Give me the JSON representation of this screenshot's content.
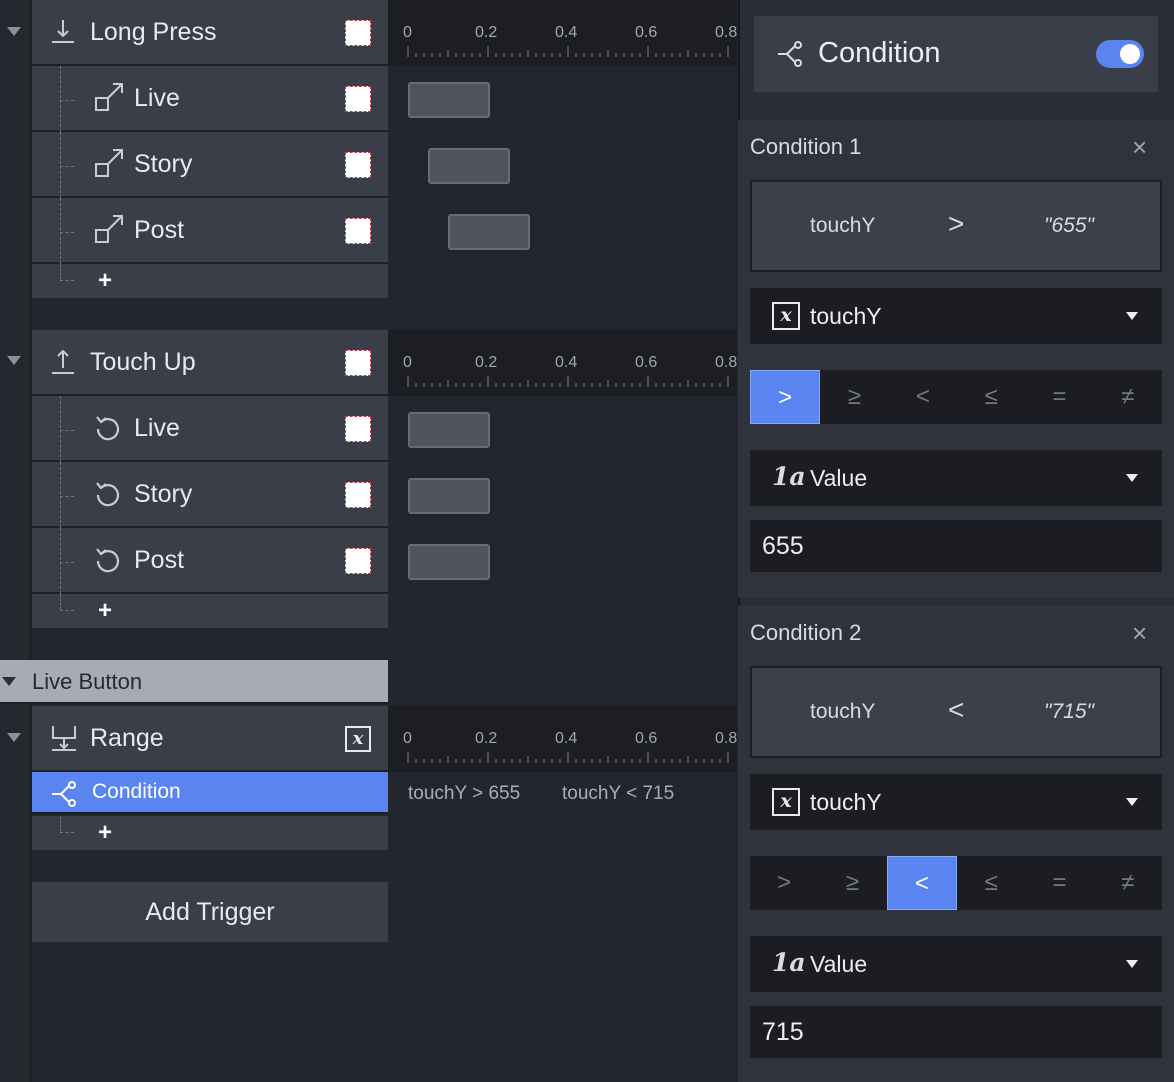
{
  "triggers": {
    "long_press": {
      "label": "Long Press",
      "children": [
        {
          "label": "Live"
        },
        {
          "label": "Story"
        },
        {
          "label": "Post"
        }
      ]
    },
    "touch_up": {
      "label": "Touch Up",
      "children": [
        {
          "label": "Live"
        },
        {
          "label": "Story"
        },
        {
          "label": "Post"
        }
      ]
    },
    "range": {
      "label": "Range",
      "children": [
        {
          "label": "Condition"
        }
      ]
    }
  },
  "add_symbol": "+",
  "group": {
    "label": "Live Button"
  },
  "add_trigger_label": "Add Trigger",
  "timeline": {
    "ticks": [
      "0",
      "0.2",
      "0.4",
      "0.6",
      "0.8"
    ],
    "range_conditions": [
      "touchY > 655",
      "touchY < 715"
    ]
  },
  "panel": {
    "title": "Condition",
    "enabled": true,
    "conditions": [
      {
        "title": "Condition 1",
        "variable": "touchY",
        "operator": ">",
        "value_display": "\"655\"",
        "value_type": "Value",
        "value": "655",
        "selected_operator_index": 0
      },
      {
        "title": "Condition 2",
        "variable": "touchY",
        "operator": "<",
        "value_display": "\"715\"",
        "value_type": "Value",
        "value": "715",
        "selected_operator_index": 2
      }
    ],
    "operators": [
      ">",
      "≥",
      "<",
      "≤",
      "=",
      "≠"
    ],
    "close_symbol": "×",
    "variable_icon": "x",
    "value_icon": "1a"
  },
  "colors": {
    "accent": "#5a84f0",
    "row_bg": "#3a3e48",
    "panel_bg": "#2b2e36",
    "dropdown_bg": "#1b1d22",
    "checkbox_border": "#c0384a"
  }
}
